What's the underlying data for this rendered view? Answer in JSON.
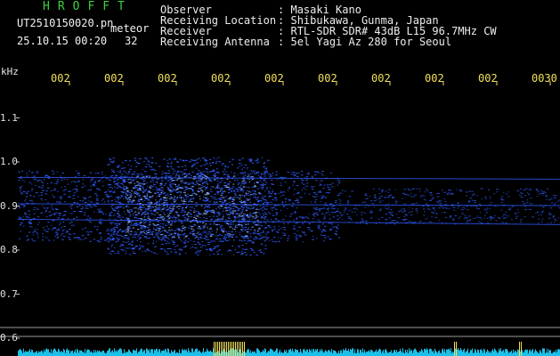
{
  "header": {
    "brand": "HROFFT",
    "filename": "UT2510150020.pn",
    "mode": "meteor",
    "datetime": "25.10.15 00:20",
    "count": "32"
  },
  "info": [
    {
      "label": "Observer",
      "sep": ":",
      "value": "Masaki Kano"
    },
    {
      "label": "Receiving Location",
      "sep": ":",
      "value": "Shibukawa, Gunma, Japan"
    },
    {
      "label": "Receiver",
      "sep": ":",
      "value": "RTL-SDR SDR# 43dB L15 96.7MHz CW"
    },
    {
      "label": "Receiving Antenna",
      "sep": ":",
      "value": "5el Yagi Az 280 for Seoul"
    }
  ],
  "chart_data": {
    "type": "heatmap",
    "ylabel": "kHz",
    "y_ticks": [
      "1.1",
      "1.0",
      "0.9",
      "0.8",
      "0.7",
      "0.6"
    ],
    "x_ticks": [
      "002",
      "002",
      "002",
      "002",
      "002",
      "002",
      "002",
      "002",
      "002",
      "0030"
    ],
    "ylim": [
      0.6,
      1.1
    ],
    "colors": {
      "background": "#000000",
      "signal": "#2f5cff",
      "bright": "#9fc0ff",
      "baseline": "#19c0e8",
      "tick": "#f1e05a"
    }
  }
}
